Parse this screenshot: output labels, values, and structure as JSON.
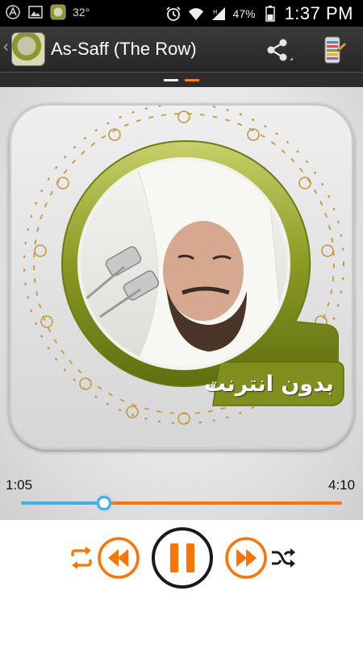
{
  "status_bar": {
    "temperature": "32°",
    "battery_percent": "47%",
    "time": "1:37 PM"
  },
  "action_bar": {
    "title": "As-Saff (The Row)"
  },
  "cover": {
    "caption": "بدون انترنت"
  },
  "player": {
    "elapsed": "1:05",
    "total": "4:10",
    "progress": 0.26
  },
  "colors": {
    "accent": "#ff7300",
    "progress": "#3fb0e6",
    "frame_green": "#8b9a22"
  },
  "icons": {
    "status_left": [
      "app-a-icon",
      "image-icon",
      "app-icon"
    ],
    "status_right": [
      "alarm-icon",
      "wifi-icon",
      "signal-icon",
      "battery-icon"
    ],
    "actions": [
      "share-icon",
      "overflow-menu-icon"
    ],
    "controls": [
      "repeat-icon",
      "previous-icon",
      "pause-icon",
      "next-icon",
      "shuffle-icon"
    ]
  }
}
